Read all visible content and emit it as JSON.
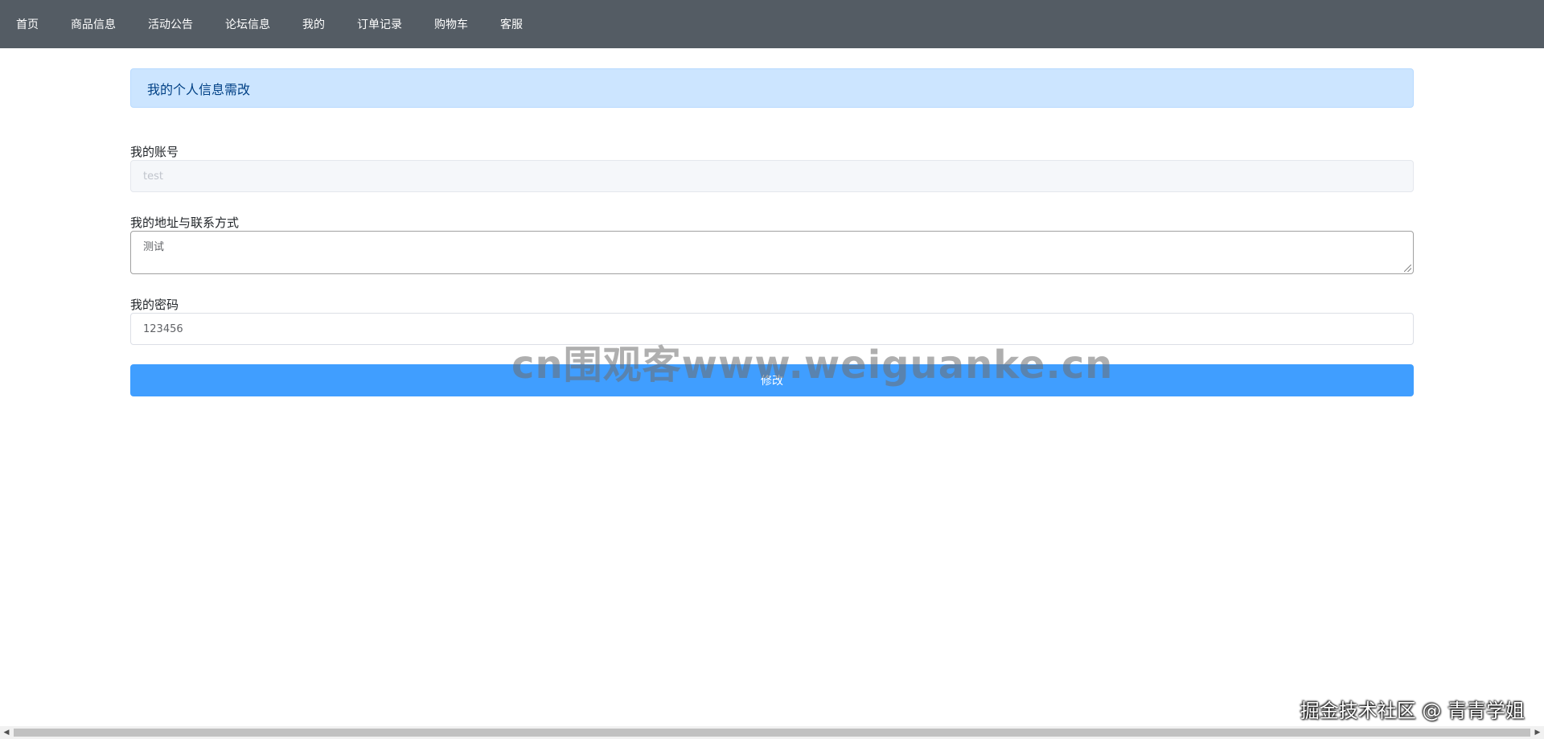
{
  "nav": {
    "items": [
      {
        "label": "首页"
      },
      {
        "label": "商品信息"
      },
      {
        "label": "活动公告"
      },
      {
        "label": "论坛信息"
      },
      {
        "label": "我的"
      },
      {
        "label": "订单记录"
      },
      {
        "label": "购物车"
      },
      {
        "label": "客服"
      }
    ]
  },
  "page": {
    "title": "我的个人信息需改"
  },
  "form": {
    "account": {
      "label": "我的账号",
      "value": "test"
    },
    "address": {
      "label": "我的地址与联系方式",
      "value": "测试"
    },
    "password": {
      "label": "我的密码",
      "value": "123456"
    },
    "submit_label": "修改"
  },
  "watermarks": {
    "center": "cn围观客www.weiguanke.cn",
    "corner": "掘金技术社区 @ 青青学姐"
  },
  "scrollbar": {
    "left_arrow": "◀",
    "right_arrow": "▶"
  },
  "colors": {
    "nav_bg": "#545c64",
    "alert_bg": "#cce5ff",
    "primary": "#409eff"
  }
}
